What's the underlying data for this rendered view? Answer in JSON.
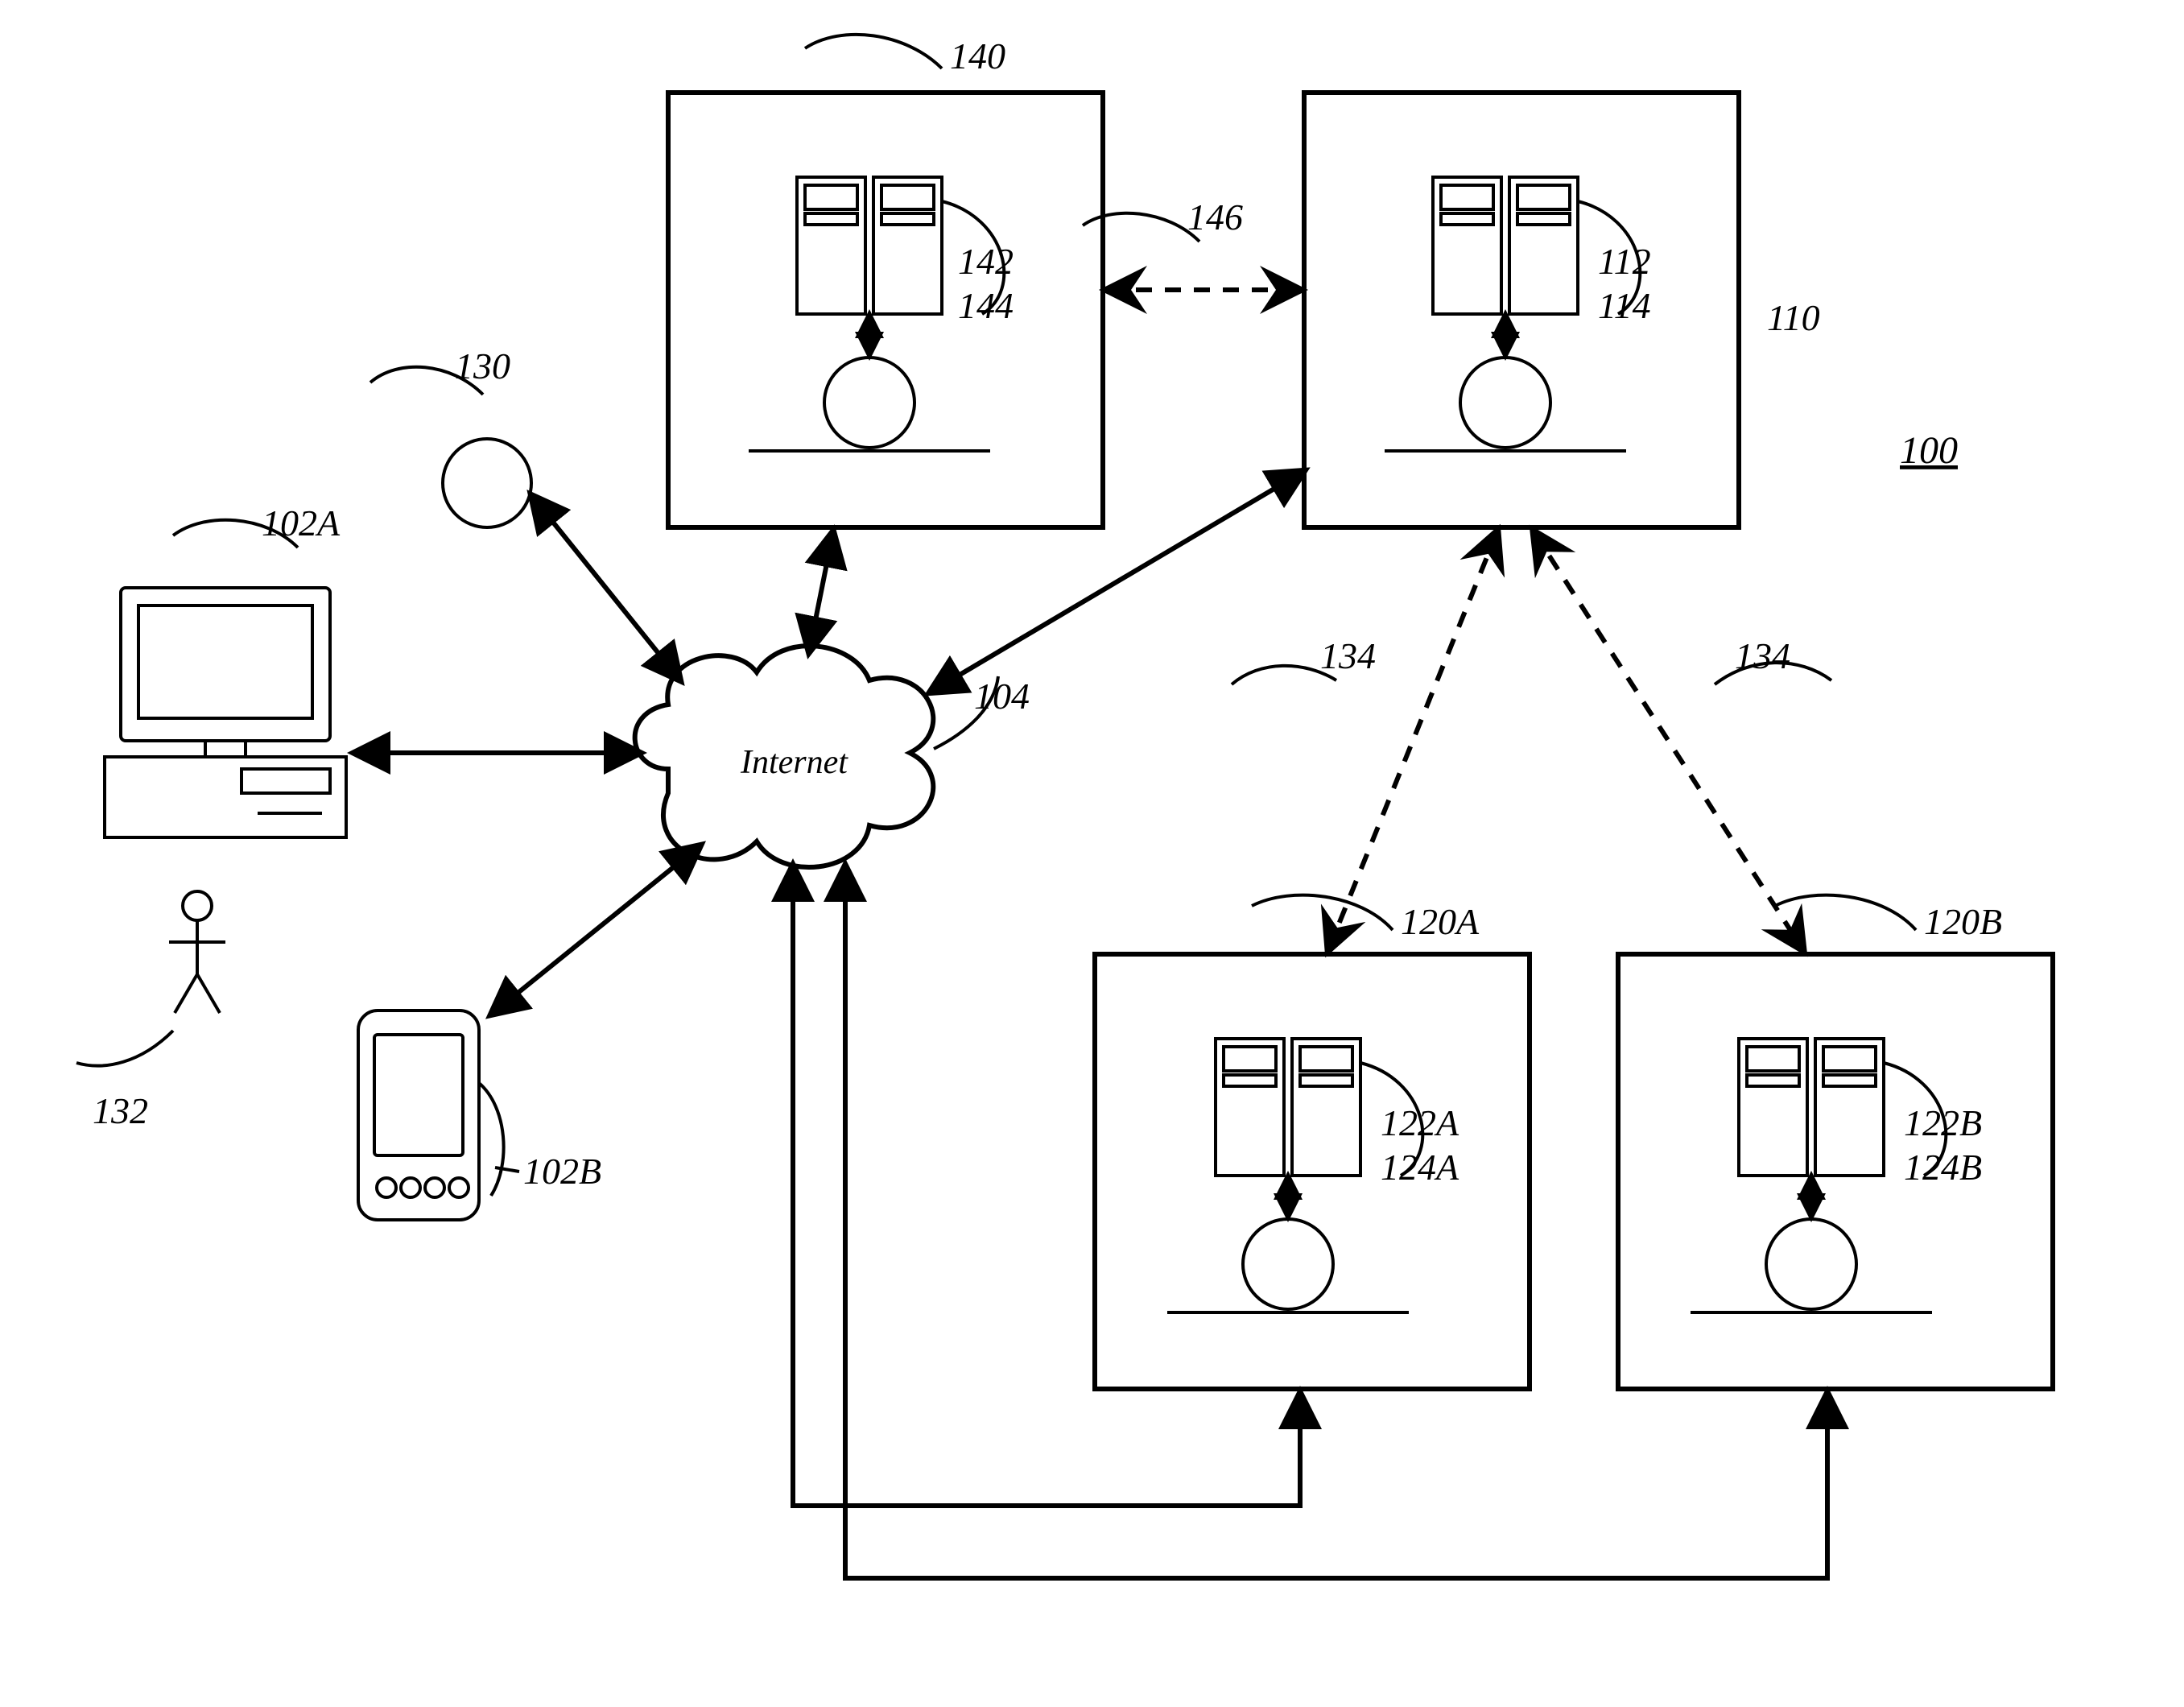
{
  "figure_id": "100",
  "cloud_label": "Internet",
  "labels": {
    "sys": "100",
    "pc": "102A",
    "pda": "102B",
    "internet": "104",
    "node_left": "130",
    "user": "132",
    "link_left": "134",
    "link_right": "134",
    "box_top_left": "140",
    "srv_top_left": "142",
    "db_top_left": "144",
    "link_top": "146",
    "box_top_right": "110",
    "srv_top_right": "112",
    "db_top_right": "114",
    "box_bottom_left": "120A",
    "srv_bottom_left": "122A",
    "db_bottom_left": "124A",
    "box_bottom_right": "120B",
    "srv_bottom_right": "122B",
    "db_bottom_right": "124B"
  }
}
